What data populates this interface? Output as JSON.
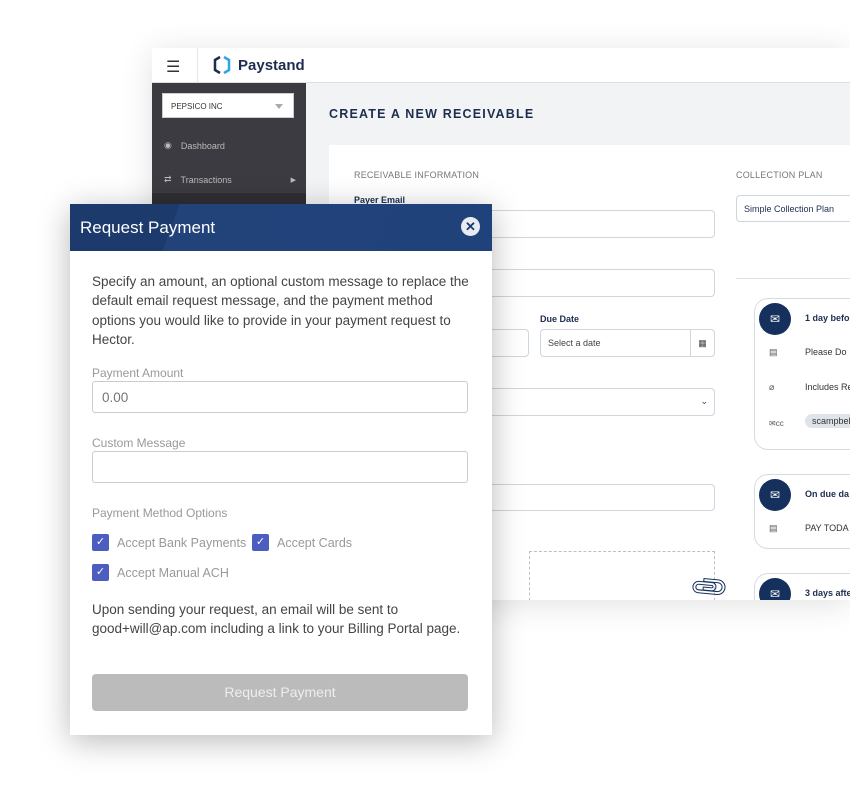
{
  "app": {
    "brand": "Paystand",
    "org": "PEPSICO INC",
    "sidebar": [
      {
        "label": "Dashboard",
        "icon": "dashboard-icon"
      },
      {
        "label": "Transactions",
        "icon": "transfer-icon"
      }
    ],
    "page_title": "CREATE A NEW RECEIVABLE",
    "receivable": {
      "section": "RECEIVABLE INFORMATION",
      "payer_email_label": "Payer Email",
      "due_date_label": "Due Date",
      "due_date_placeholder": "Select a date"
    },
    "collection": {
      "section": "COLLECTION PLAN",
      "plan": "Simple Collection Plan",
      "steps": [
        {
          "title": "1 day befo",
          "rows": [
            "Please Do",
            "Includes Re"
          ],
          "cc": "scampbel"
        },
        {
          "title": "On due da",
          "rows": [
            "PAY TODA"
          ]
        },
        {
          "title": "3 days afte"
        }
      ]
    }
  },
  "modal": {
    "title": "Request Payment",
    "intro": "Specify an amount, an optional custom message to replace the default email request message, and the payment method options you would like to provide in your payment request to Hector.",
    "amount_label": "Payment Amount",
    "amount_placeholder": "0.00",
    "message_label": "Custom Message",
    "options_label": "Payment Method Options",
    "options": [
      {
        "label": "Accept Bank Payments",
        "checked": true
      },
      {
        "label": "Accept Cards",
        "checked": true
      },
      {
        "label": "Accept Manual ACH",
        "checked": true
      }
    ],
    "footer": "Upon sending your request, an email will be sent to good+will@ap.com including a link to your Billing Portal page.",
    "submit": "Request Payment"
  },
  "colors": {
    "header": "#1c3a6c",
    "checkbox": "#4d5dbf",
    "navy": "#15305c"
  }
}
